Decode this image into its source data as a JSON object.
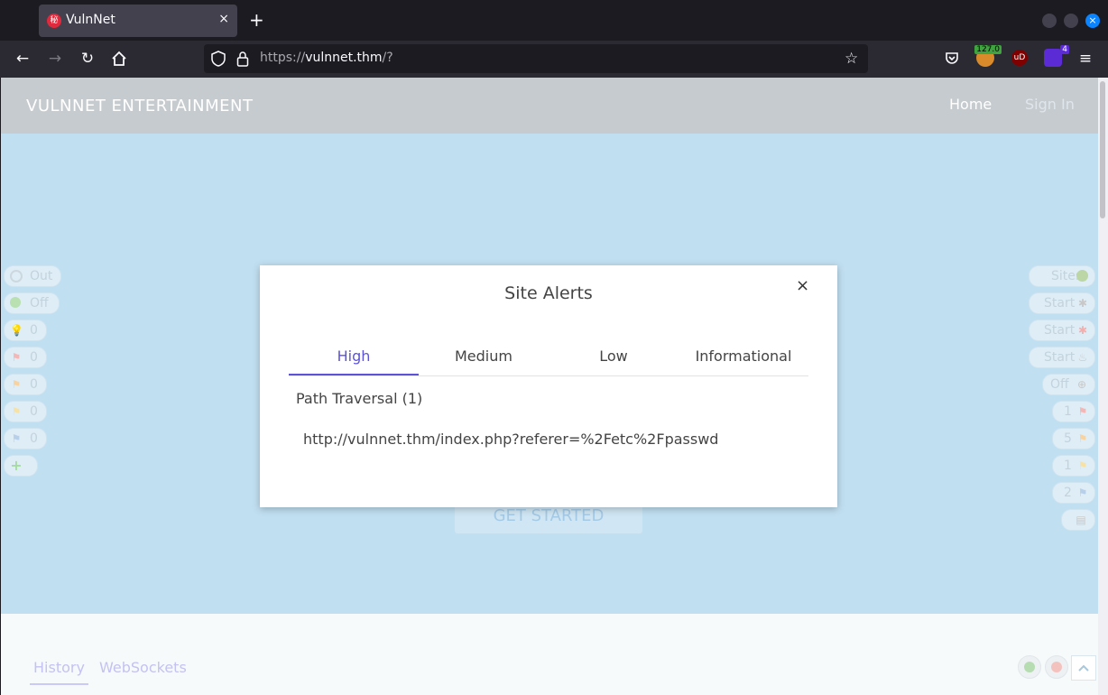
{
  "browser": {
    "tab_title": "VulnNet",
    "tab_favicon_text": "秘",
    "tab_close": "×",
    "new_tab": "+",
    "url_scheme": "https://",
    "url_host": "vulnnet.thm",
    "url_path": "/?",
    "ext_badge": "127.0",
    "ext_ublock": "uD",
    "ext_count": "4",
    "window_close": "×"
  },
  "site": {
    "brand": "VULNNET ENTERTAINMENT",
    "nav": [
      "Home",
      "Sign In"
    ],
    "cta": "GET STARTED"
  },
  "hud": {
    "left_pills": [
      "Out",
      "Off",
      "0",
      "0",
      "0",
      "0",
      "0"
    ],
    "right_pills": [
      "Sites",
      "Start",
      "Start",
      "Start",
      "Off",
      "1",
      "5",
      "1",
      "2"
    ],
    "bottom_tabs": [
      "History",
      "WebSockets"
    ],
    "colors": {
      "high": "#e05252",
      "medium": "#f0a030",
      "low": "#f2c94c",
      "info": "#6d9bd1"
    }
  },
  "modal": {
    "title": "Site Alerts",
    "close": "×",
    "tabs": [
      "High",
      "Medium",
      "Low",
      "Informational"
    ],
    "active_tab": "High",
    "alert_group": "Path Traversal (1)",
    "alert_url": "http://vulnnet.thm/index.php?referer=%2Fetc%2Fpasswd",
    "accent": "#5c53d8"
  }
}
